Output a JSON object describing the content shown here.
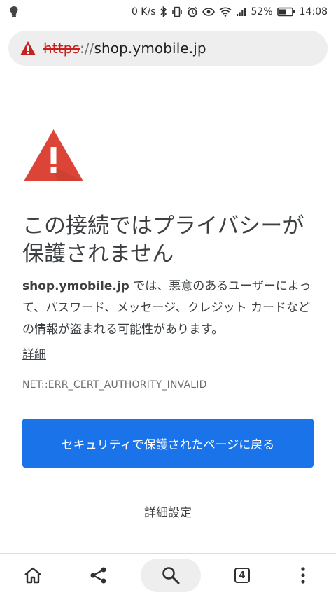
{
  "status_bar": {
    "net_speed": "0 K/s",
    "battery_percent": "52%",
    "time": "14:08",
    "icons": [
      "lightbulb-notification-icon",
      "bluetooth-icon",
      "vibrate-icon",
      "alarm-icon",
      "eye-comfort-icon",
      "wifi-icon",
      "signal-icon",
      "battery-icon"
    ]
  },
  "url_bar": {
    "scheme": "https",
    "separator": "://",
    "host": "shop.ymobile.jp",
    "icon": "not-secure-warning-icon"
  },
  "interstitial": {
    "headline": "この接続ではプライバシーが保護されません",
    "host": "shop.ymobile.jp",
    "message": " では、悪意のあるユーザーによって、パスワード、メッセージ、クレジット カードなどの情報が盗まれる可能性があります。",
    "details_link": "詳細",
    "error_code": "NET::ERR_CERT_AUTHORITY_INVALID",
    "back_button": "セキュリティで保護されたページに戻る",
    "advanced_button": "詳細設定"
  },
  "bottom_toolbar": {
    "tab_count": "4",
    "icons": [
      "home-icon",
      "share-icon",
      "search-icon",
      "tab-switcher-icon",
      "more-vert-icon"
    ]
  },
  "colors": {
    "warning_red": "#db4437",
    "primary_button": "#1a73e8",
    "url_bar_bg": "#eeeeee"
  }
}
